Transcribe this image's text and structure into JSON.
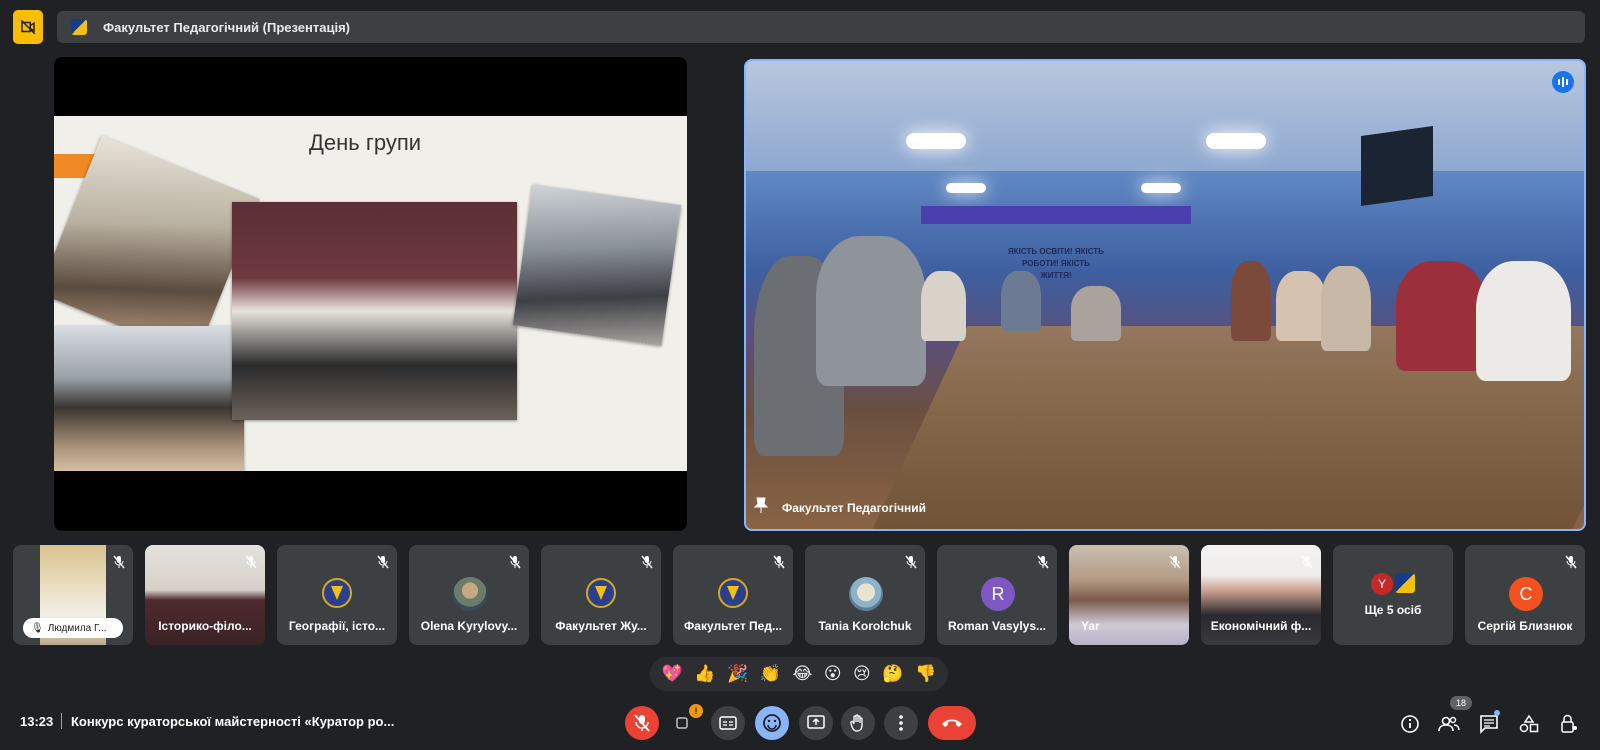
{
  "header": {
    "title": "Факультет Педагогічний (Презентація)"
  },
  "presentation": {
    "slide_title": "День групи"
  },
  "main_video": {
    "name": "Факультет Педагогічний",
    "wall_text": "ЯКІСТЬ ОСВІТИ! ЯКІСТЬ РОБОТИ! ЯКІСТЬ ЖИТТЯ!"
  },
  "participants": [
    {
      "name": "Людмила Г..."
    },
    {
      "name": "Історико-філо..."
    },
    {
      "name": "Географії, істо..."
    },
    {
      "name": "Olena Kyrylovy..."
    },
    {
      "name": "Факультет Жу..."
    },
    {
      "name": "Факультет Пед..."
    },
    {
      "name": "Tania Korolchuk"
    },
    {
      "name": "Roman Vasylys...",
      "initial": "R"
    },
    {
      "name": "Yar"
    },
    {
      "name": "Економічний ф..."
    },
    {
      "name": "Ще 5 осіб",
      "initial": "Y"
    },
    {
      "name": "Сергій Близнюк",
      "initial": "С"
    }
  ],
  "reactions": [
    "💖",
    "👍",
    "🎉",
    "👏",
    "😂",
    "😮",
    "😢",
    "🤔",
    "👎"
  ],
  "bottom_bar": {
    "time": "13:23",
    "meeting_title": "Конкурс кураторської майстерності «Куратор ро...",
    "camera_badge": "!",
    "people_count": "18"
  },
  "colors": {
    "background": "#202124",
    "tile": "#3c4043",
    "accent": "#8ab4f8",
    "danger": "#ea4335",
    "warning": "#fbbc04"
  }
}
